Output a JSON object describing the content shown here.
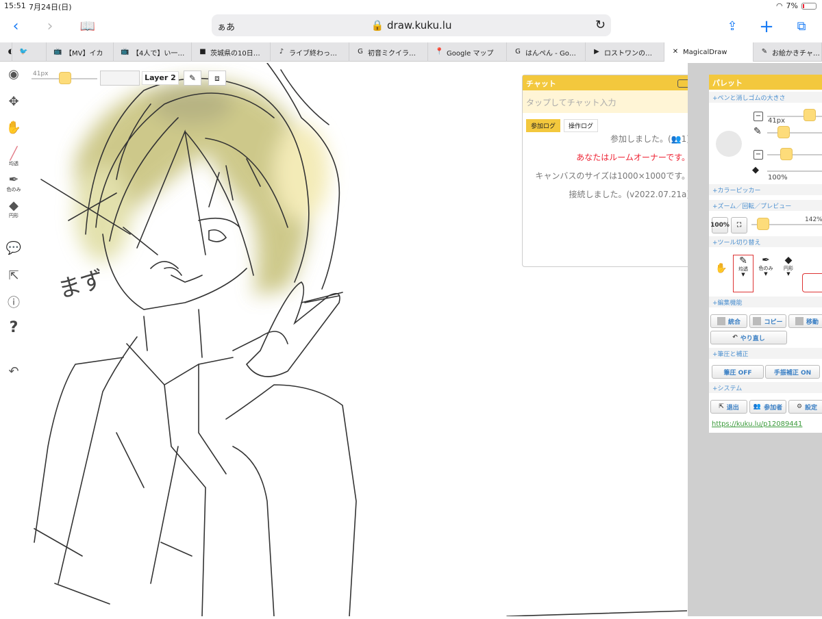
{
  "status": {
    "time": "15:51",
    "date": "7月24日(日)",
    "battery": "7%"
  },
  "browser": {
    "aa_label": "ぁあ",
    "url": "draw.kuku.lu",
    "tabs": [
      {
        "label": "",
        "icon": "browser-tab-icon"
      },
      {
        "label": "",
        "icon": "twitter-icon"
      },
      {
        "label": "【MV】イカ",
        "icon": "nicovideo-icon"
      },
      {
        "label": "【4人で】い一…",
        "icon": "nicovideo-icon"
      },
      {
        "label": "茨城県の10日…",
        "icon": "weather-news-icon"
      },
      {
        "label": "ライブ終わっ…",
        "icon": "tiktok-icon"
      },
      {
        "label": "初音ミクイラ…",
        "icon": "google-icon"
      },
      {
        "label": "Google マップ",
        "icon": "maps-pin-icon"
      },
      {
        "label": "はんぺん - Go…",
        "icon": "google-icon"
      },
      {
        "label": "ロストワンの…",
        "icon": "youtube-icon"
      },
      {
        "label": "MagicalDraw",
        "icon": "close-icon"
      },
      {
        "label": "お絵かきチャ…",
        "icon": "draw-app-icon"
      }
    ]
  },
  "left_tools": [
    {
      "name": "color-wheel-icon",
      "label": ""
    },
    {
      "name": "move-icon",
      "label": ""
    },
    {
      "name": "hand-icon",
      "label": ""
    },
    {
      "name": "pen-icon",
      "label": "均透"
    },
    {
      "name": "eyedropper-icon",
      "label": "色のみ"
    },
    {
      "name": "eraser-icon",
      "label": "円形"
    },
    {
      "name": "chat-bubble-icon",
      "label": ""
    },
    {
      "name": "exit-icon",
      "label": ""
    },
    {
      "name": "info-icon",
      "label": ""
    },
    {
      "name": "help-icon",
      "label": ""
    },
    {
      "name": "undo-icon",
      "label": ""
    }
  ],
  "canvas_toolbar": {
    "size_label": "41px",
    "layer_label": "Layer 2"
  },
  "canvas_handwriting": "まず",
  "chat": {
    "title": "チャット",
    "placeholder": "タップしてチャット入力",
    "tabs": [
      "参加ログ",
      "操作ログ"
    ],
    "messages": [
      {
        "text": "参加しました。(👥1)",
        "color": "gray"
      },
      {
        "text": "あなたはルームオーナーです。",
        "color": "red"
      },
      {
        "text": "キャンバスのサイズは1000×1000です。",
        "color": "gray"
      },
      {
        "text": "接続しました。(v2022.07.21a)",
        "color": "gray"
      }
    ]
  },
  "palette": {
    "title": "パレット",
    "sections": {
      "brush": "+ペンと消しゴムの大きさ",
      "picker": "+カラーピッカー",
      "zoom": "+ズーム／回転／プレビュー",
      "tools": "+ツール切り替え",
      "edit": "+編集機能",
      "pressure": "+筆圧と補正",
      "system": "+システム"
    },
    "pen_size": "41px",
    "eraser_opacity": "100%",
    "zoom_reset": "100%",
    "zoom_level": "142%",
    "tool_labels": [
      "均透",
      "色のみ",
      "円形"
    ],
    "edit_buttons": [
      "統合",
      "コピー",
      "移動"
    ],
    "redo": "やり直し",
    "pressure_buttons": [
      "筆圧 OFF",
      "手振補正 ON"
    ],
    "system_buttons": [
      "退出",
      "参加者",
      "設定"
    ],
    "room_url": "https://kuku.lu/p12089441"
  },
  "colors": {
    "accent": "#f3c83d",
    "link": "#1a7cf5",
    "hair_tint": "#c8c070"
  }
}
